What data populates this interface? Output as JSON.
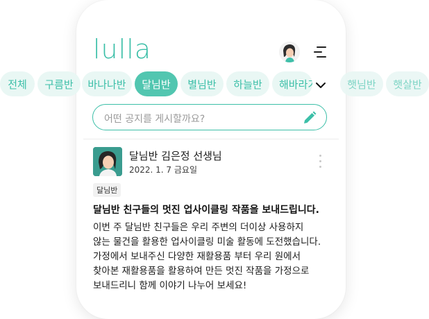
{
  "app": {
    "logo": "lulla"
  },
  "header": {
    "avatar_icon": "profile-avatar-woman",
    "menu_icon": "hamburger-menu-icon"
  },
  "tabs": [
    {
      "label": "전체"
    },
    {
      "label": "구름반"
    },
    {
      "label": "바나나반"
    },
    {
      "label": "달님반",
      "active": true
    },
    {
      "label": "별님반"
    },
    {
      "label": "하늘반"
    },
    {
      "label": "해바라기반"
    },
    {
      "label": "햇님반"
    },
    {
      "label": "햇살반"
    }
  ],
  "search": {
    "placeholder": "어떤 공지를 게시할까요?"
  },
  "post": {
    "author": "달님반 김은정 선생님",
    "date": "2022. 1. 7 금요일",
    "badge": "달님반",
    "title": "달님반 친구들의 멋진 업사이클링 작품을 보내드립니다.",
    "body_lines": [
      "이번 주 달님반 친구들은 우리 주변의 더이상 사용하지",
      "않는 물건을 활용한 업사이클링 미술 활동에 도전했습니다.",
      "가정에서 보내주신 다양한 재활용품 부터 우리 원에서",
      "찾아본 재활용품을 활용하여 만든 멋진 작품을 가정으로",
      "보내드리니 함께 이야기 나누어 보세요!"
    ]
  },
  "colors": {
    "accent": "#3cbfa8",
    "accent_active": "#52c6b0",
    "tab_bg": "#e9f7f4"
  }
}
